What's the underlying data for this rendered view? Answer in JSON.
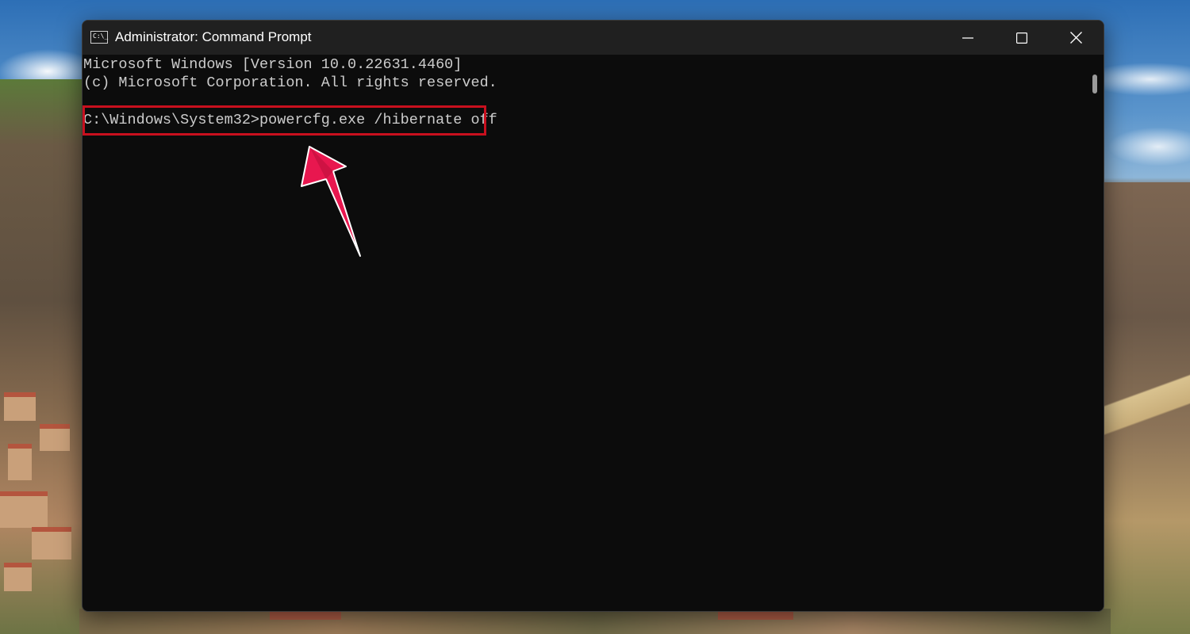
{
  "window": {
    "title": "Administrator: Command Prompt",
    "app_icon_text": "C:\\_",
    "controls": {
      "minimize": "minimize-icon",
      "maximize": "maximize-icon",
      "close": "close-icon"
    }
  },
  "console": {
    "line1": "Microsoft Windows [Version 10.0.22631.4460]",
    "line2": "(c) Microsoft Corporation. All rights reserved.",
    "line3": "",
    "line4": "C:\\Windows\\System32>powercfg.exe /hibernate off"
  },
  "annotation": {
    "icon": "arrow-annotation-icon",
    "highlight_color": "#c8101e",
    "arrow_color": "#e8174f"
  },
  "colors": {
    "console_bg": "#0c0c0c",
    "console_text": "#cccccc",
    "titlebar_bg": "#202020"
  }
}
